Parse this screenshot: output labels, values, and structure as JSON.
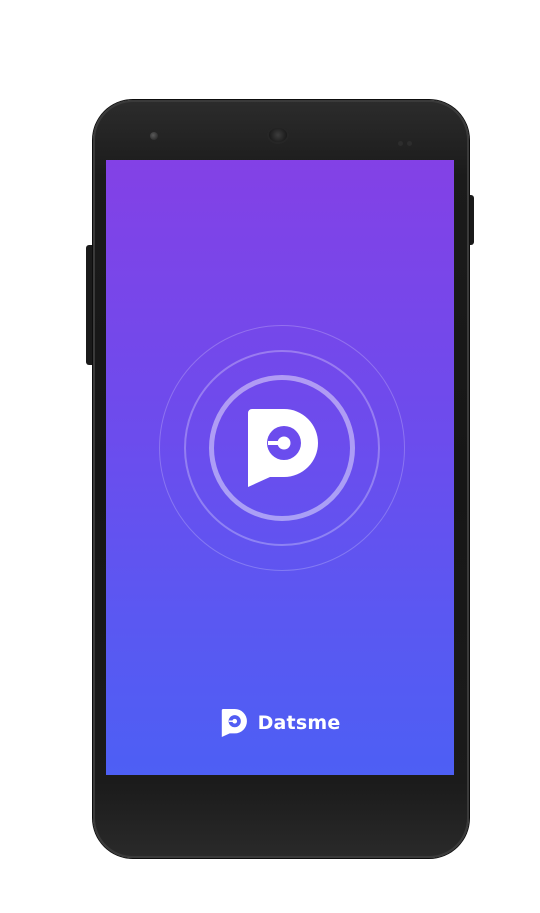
{
  "app": {
    "name": "Datsme"
  },
  "icons": {
    "logo": "datsme-logo-icon"
  },
  "colors": {
    "gradient_top": "#8341e6",
    "gradient_bottom": "#4d5ff4",
    "text": "#ffffff",
    "device_body": "#161616"
  }
}
